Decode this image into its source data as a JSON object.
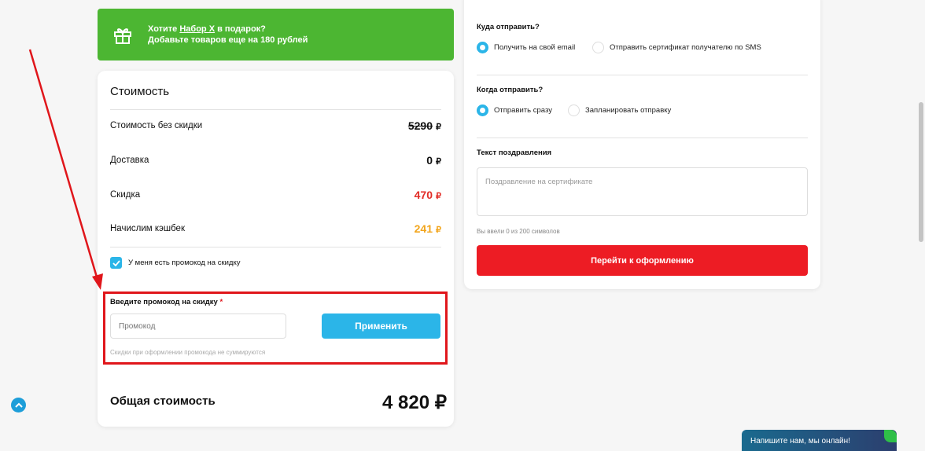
{
  "banner": {
    "line1_prefix": "Хотите ",
    "line1_link": "Набор X",
    "line1_suffix": " в подарок?",
    "line2": "Добавьте товаров еще на 180 рублей"
  },
  "summary": {
    "title": "Стоимость",
    "rows": [
      {
        "label": "Стоимость без скидки",
        "value": "5290",
        "currency": "₽"
      },
      {
        "label": "Доставка",
        "value": "0",
        "currency": "₽"
      },
      {
        "label": "Скидка",
        "value": "470",
        "currency": "₽"
      },
      {
        "label": "Начислим кэшбек",
        "value": "241",
        "currency": "₽"
      }
    ],
    "promo_checkbox_label": "У меня есть промокод на скидку",
    "promo_label": "Введите промокод на скидку",
    "promo_required_mark": "*",
    "promo_placeholder": "Промокод",
    "apply_button": "Применить",
    "promo_hint": "Скидки при оформлении промокода не суммируются",
    "total_label": "Общая стоимость",
    "total_value": "4 820 ₽"
  },
  "delivery": {
    "where_label": "Куда отправить?",
    "where_options": [
      "Получить на свой email",
      "Отправить сертификат получателю по SMS"
    ],
    "when_label": "Когда отправить?",
    "when_options": [
      "Отправить сразу",
      "Запланировать отправку"
    ],
    "greeting_label": "Текст поздравления",
    "greeting_placeholder": "Поздравление на сертификате",
    "counter": "Вы ввели 0 из 200 символов",
    "checkout_button": "Перейти к оформлению"
  },
  "chat": {
    "label": "Напишите нам, мы онлайн!"
  },
  "colors": {
    "green": "#4cb632",
    "blue": "#2bb5e8",
    "red": "#ed1c24",
    "orange": "#f2a51c"
  }
}
